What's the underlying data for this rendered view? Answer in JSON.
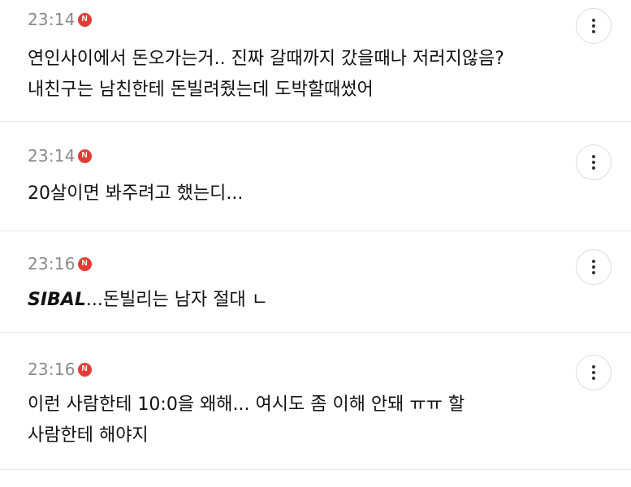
{
  "comments": [
    {
      "time": "23:14",
      "badge": "N",
      "lines": [
        "연인사이에서 돈오가는거.. 진짜 갈때까지 갔을때나 저러지않음?",
        "내친구는 남친한테 돈빌려줬는데 도박할때썼어"
      ]
    },
    {
      "time": "23:14",
      "badge": "N",
      "lines": [
        "20살이면 봐주려고 했는디..."
      ]
    },
    {
      "time": "23:16",
      "badge": "N",
      "emphasis": "SIBAL",
      "rest": "...돈빌리는 남자 절대 ㄴ"
    },
    {
      "time": "23:16",
      "badge": "N",
      "lines": [
        "이런 사람한테 10:0을 왜해... 여시도 좀 이해 안돼 ㅠㅠ 할",
        "사람한테 해야지"
      ]
    }
  ],
  "colors": {
    "badge": "#e63a36",
    "time": "#8a8a8a",
    "divider": "#e6e6e6"
  },
  "icons": {
    "more": "more-vertical-icon"
  }
}
